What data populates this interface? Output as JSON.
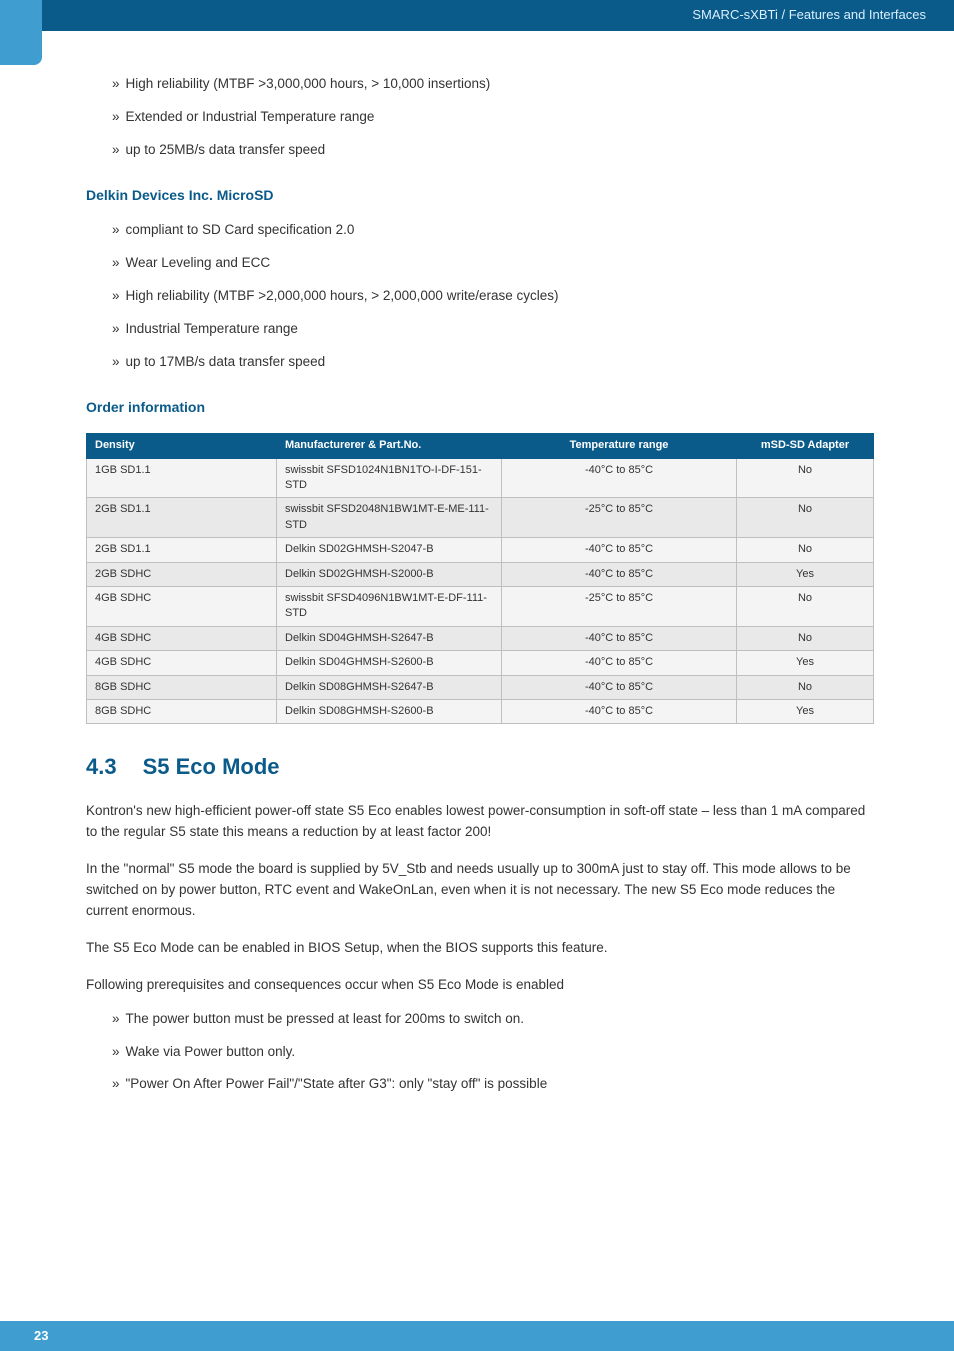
{
  "header": {
    "breadcrumb": "SMARC-sXBTi / Features and Interfaces"
  },
  "topBullets": [
    "High reliability (MTBF >3,000,000 hours, > 10,000 insertions)",
    "Extended or Industrial Temperature range",
    "up to 25MB/s data transfer speed"
  ],
  "delkin": {
    "heading": "Delkin Devices Inc. MicroSD",
    "bullets": [
      "compliant to SD Card specification 2.0",
      "Wear Leveling and ECC",
      "High reliability (MTBF >2,000,000 hours, > 2,000,000 write/erase cycles)",
      "Industrial Temperature range",
      "up to 17MB/s data transfer speed"
    ]
  },
  "order": {
    "heading": "Order information",
    "cols": {
      "density": "Density",
      "part": "Manufacturerer & Part.No.",
      "temp": "Temperature range",
      "adapter": "mSD-SD Adapter"
    },
    "rows": [
      {
        "density": "1GB SD1.1",
        "part": "swissbit SFSD1024N1BN1TO-I-DF-151-STD",
        "temp": "-40°C to 85°C",
        "adapter": "No"
      },
      {
        "density": "2GB SD1.1",
        "part": "swissbit SFSD2048N1BW1MT-E-ME-111-STD",
        "temp": "-25°C to 85°C",
        "adapter": "No"
      },
      {
        "density": "2GB SD1.1",
        "part": "Delkin SD02GHMSH-S2047-B",
        "temp": "-40°C to 85°C",
        "adapter": "No"
      },
      {
        "density": "2GB SDHC",
        "part": "Delkin SD02GHMSH-S2000-B",
        "temp": "-40°C to 85°C",
        "adapter": "Yes"
      },
      {
        "density": "4GB SDHC",
        "part": "swissbit SFSD4096N1BW1MT-E-DF-111-STD",
        "temp": "-25°C to 85°C",
        "adapter": "No"
      },
      {
        "density": "4GB SDHC",
        "part": "Delkin SD04GHMSH-S2647-B",
        "temp": "-40°C to 85°C",
        "adapter": "No"
      },
      {
        "density": "4GB SDHC",
        "part": "Delkin SD04GHMSH-S2600-B",
        "temp": "-40°C to 85°C",
        "adapter": "Yes"
      },
      {
        "density": "8GB SDHC",
        "part": "Delkin SD08GHMSH-S2647-B",
        "temp": "-40°C to 85°C",
        "adapter": "No"
      },
      {
        "density": "8GB SDHC",
        "part": "Delkin SD08GHMSH-S2600-B",
        "temp": "-40°C to 85°C",
        "adapter": "Yes"
      }
    ]
  },
  "section": {
    "number": "4.3",
    "title": "S5 Eco Mode",
    "paras": [
      "Kontron's new high-efficient power-off state S5 Eco enables lowest power-consumption in soft-off state – less than 1 mA compared to the regular S5 state this means a reduction by at least factor 200!",
      "In the \"normal\" S5 mode the board is supplied by 5V_Stb and needs usually up to 300mA just to stay off. This mode allows to be switched on by power button, RTC event and WakeOnLan, even when it is not necessary. The new S5 Eco mode reduces the current enormous.",
      "The S5 Eco Mode can be enabled in BIOS Setup, when the BIOS supports this feature.",
      "Following prerequisites and consequences occur when S5 Eco Mode is enabled"
    ],
    "bullets": [
      "The power button must be pressed at least for 200ms to switch on.",
      "Wake via Power button only.",
      "\"Power On After Power Fail\"/\"State after G3\": only \"stay off\" is possible"
    ]
  },
  "footer": {
    "page": "23"
  }
}
